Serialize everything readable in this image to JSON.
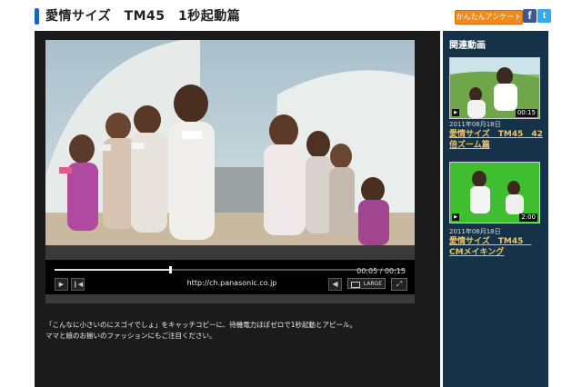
{
  "header": {
    "title": "愛情サイズ　TM45　1秒起動篇",
    "survey_label": "かんたんアンケート",
    "facebook_label": "f",
    "twitter_label": "t"
  },
  "player": {
    "time": "00:05 / 00:15",
    "progress": 0.33,
    "url": "http://ch.panasonic.co.jp",
    "play_label": "▶",
    "rewind_label": "❙◀",
    "volume_label": "◀",
    "large_label": "LARGE",
    "fullscreen_label": "⤢"
  },
  "description": [
    "「こんなに小さいのにスゴイでしょ」をキャッチコピーに、待機電力ほぼゼロで1秒起動とアピール。",
    "ママと娘のお揃いのファッションにもご注目ください。"
  ],
  "sidebar": {
    "title": "関連動画",
    "items": [
      {
        "duration": "00:15",
        "date": "2011年08月18日",
        "title": "愛情サイズ　TM45　42倍ズーム篇"
      },
      {
        "duration": "2:00",
        "date": "2011年08月18日",
        "title": "愛情サイズ　TM45　CMメイキング"
      }
    ]
  },
  "colors": {
    "accent": "#1d63b6",
    "panel": "#1b1b1b",
    "sidebar": "#163248",
    "link": "#e7c66a",
    "survey": "#f08a1c"
  }
}
